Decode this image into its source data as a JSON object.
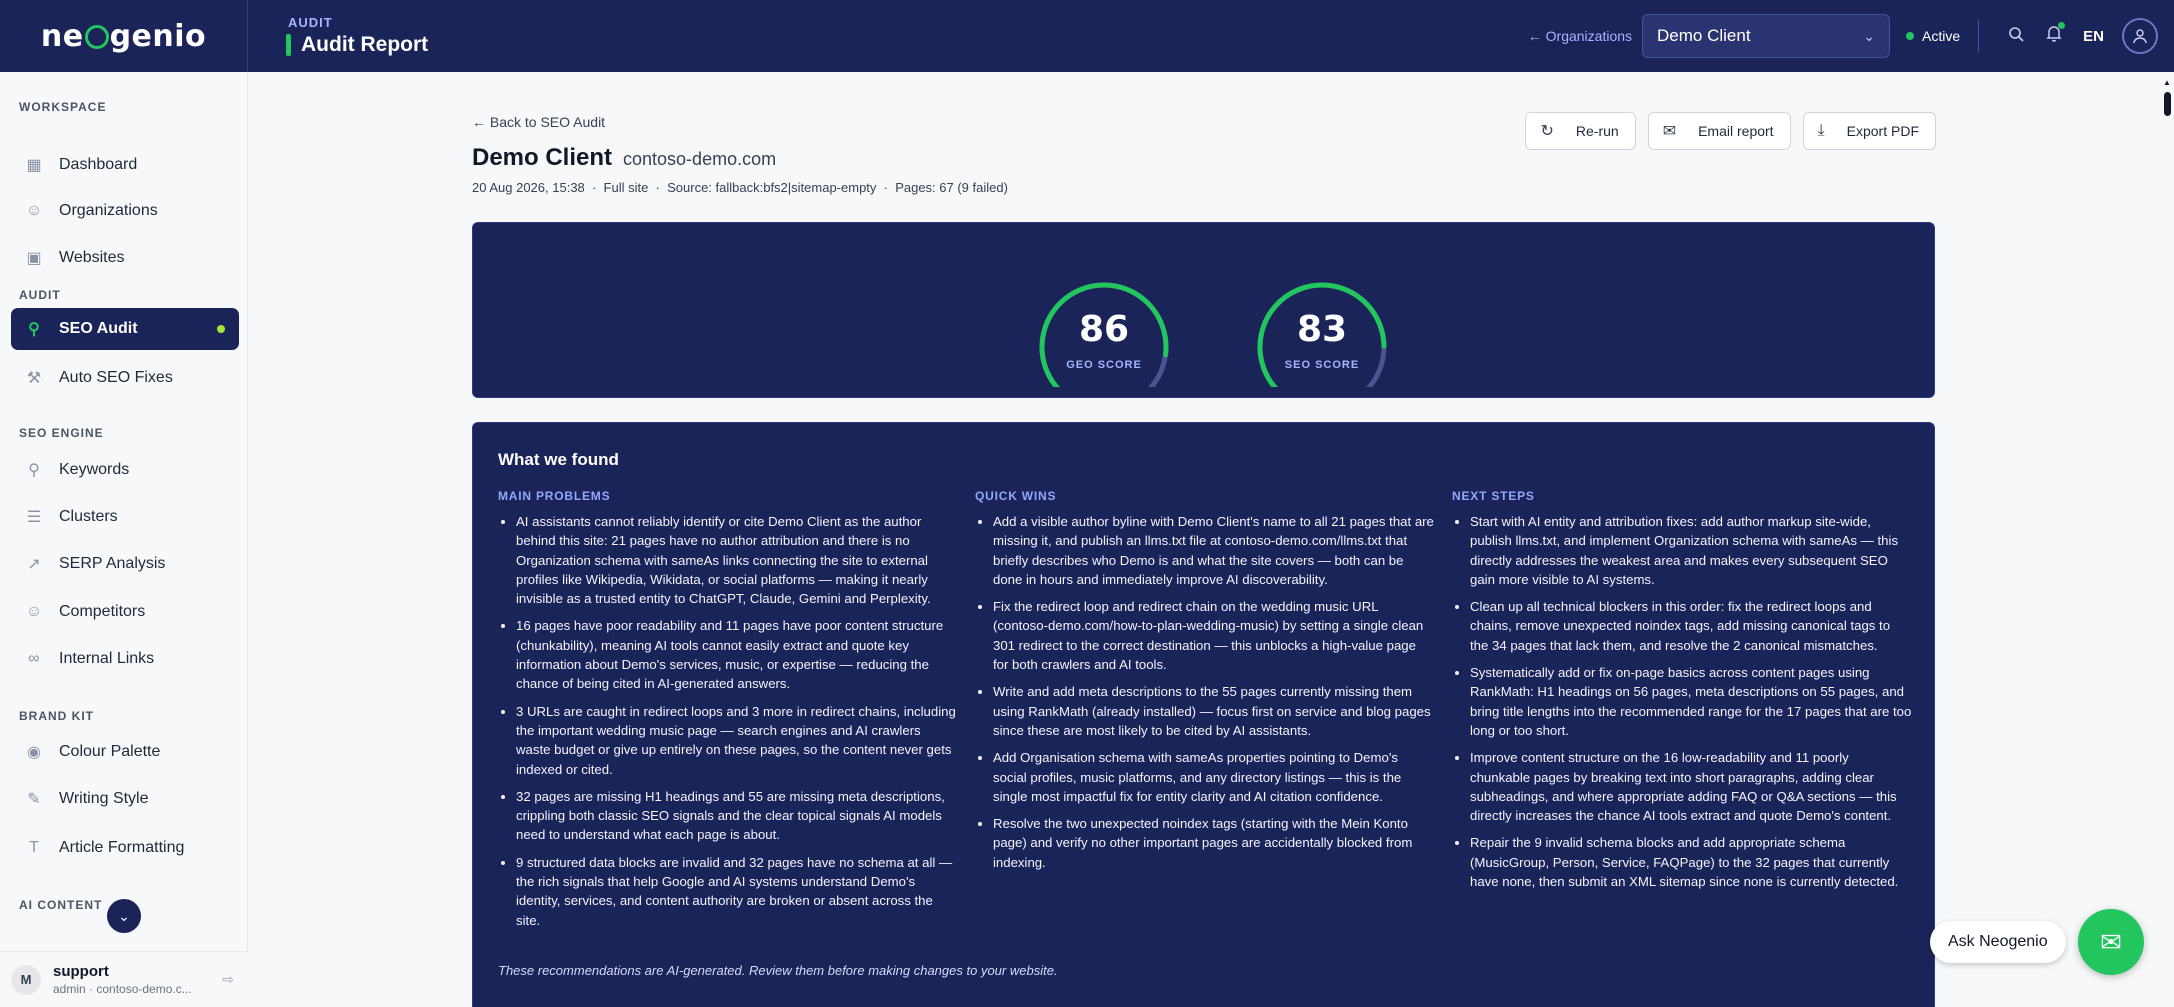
{
  "app": {
    "logo_text": "neogenio"
  },
  "header": {
    "kicker": "AUDIT",
    "title": "Audit Report",
    "org_link": "← Organizations",
    "org_selected": "Demo Client",
    "status": "Active",
    "lang": "EN"
  },
  "sidebar": {
    "sections": [
      {
        "label": "WORKSPACE"
      },
      {
        "label": "AUDIT"
      },
      {
        "label": "SEO ENGINE"
      },
      {
        "label": "BRAND KIT"
      },
      {
        "label": "AI CONTENT"
      }
    ],
    "items": [
      {
        "label": "Dashboard",
        "icon": "grid-icon"
      },
      {
        "label": "Organizations",
        "icon": "users-icon"
      },
      {
        "label": "Websites",
        "icon": "browser-icon"
      },
      {
        "label": "SEO Audit",
        "icon": "search-icon",
        "active": true
      },
      {
        "label": "Auto SEO Fixes",
        "icon": "wrench-icon"
      },
      {
        "label": "Keywords",
        "icon": "search-icon"
      },
      {
        "label": "Clusters",
        "icon": "layers-icon"
      },
      {
        "label": "SERP Analysis",
        "icon": "chart-line-icon"
      },
      {
        "label": "Competitors",
        "icon": "users-icon"
      },
      {
        "label": "Internal Links",
        "icon": "link-icon"
      },
      {
        "label": "Colour Palette",
        "icon": "palette-icon"
      },
      {
        "label": "Writing Style",
        "icon": "pen-icon"
      },
      {
        "label": "Article Formatting",
        "icon": "text-icon"
      }
    ],
    "user": {
      "initial": "M",
      "name": "support",
      "sub": "admin · contoso-demo.c..."
    }
  },
  "report": {
    "back_label": "Back to SEO Audit",
    "client_name": "Demo Client",
    "client_domain": "contoso-demo.com",
    "meta": "20 Aug 2026, 15:38  ·  Full site  ·  Source: fallback:bfs2|sitemap-empty  ·  Pages: 67 (9 failed)",
    "actions": {
      "rerun": "Re-run",
      "email": "Email report",
      "export": "Export PDF"
    },
    "scores": [
      {
        "value": "86",
        "label": "GEO SCORE",
        "fraction": 0.86
      },
      {
        "value": "83",
        "label": "SEO SCORE",
        "fraction": 0.83
      }
    ],
    "findings": {
      "title": "What we found",
      "columns": [
        {
          "heading": "MAIN PROBLEMS",
          "items": [
            "AI assistants cannot reliably identify or cite Demo Client as the author behind this site: 21 pages have no author attribution and there is no Organization schema with sameAs links connecting the site to external profiles like Wikipedia, Wikidata, or social platforms — making it nearly invisible as a trusted entity to ChatGPT, Claude, Gemini and Perplexity.",
            "16 pages have poor readability and 11 pages have poor content structure (chunkability), meaning AI tools cannot easily extract and quote key information about Demo's services, music, or expertise — reducing the chance of being cited in AI-generated answers.",
            "3 URLs are caught in redirect loops and 3 more in redirect chains, including the important wedding music page — search engines and AI crawlers waste budget or give up entirely on these pages, so the content never gets indexed or cited.",
            "32 pages are missing H1 headings and 55 are missing meta descriptions, crippling both classic SEO signals and the clear topical signals AI models need to understand what each page is about.",
            "9 structured data blocks are invalid and 32 pages have no schema at all — the rich signals that help Google and AI systems understand Demo's identity, services, and content authority are broken or absent across the site."
          ]
        },
        {
          "heading": "QUICK WINS",
          "items": [
            "Add a visible author byline with Demo Client's name to all 21 pages that are missing it, and publish an llms.txt file at contoso-demo.com/llms.txt that briefly describes who Demo is and what the site covers — both can be done in hours and immediately improve AI discoverability.",
            "Fix the redirect loop and redirect chain on the wedding music URL (contoso-demo.com/how-to-plan-wedding-music) by setting a single clean 301 redirect to the correct destination — this unblocks a high-value page for both crawlers and AI tools.",
            "Write and add meta descriptions to the 55 pages currently missing them using RankMath (already installed) — focus first on service and blog pages since these are most likely to be cited by AI assistants.",
            "Add Organisation schema with sameAs properties pointing to Demo's social profiles, music platforms, and any directory listings — this is the single most impactful fix for entity clarity and AI citation confidence.",
            "Resolve the two unexpected noindex tags (starting with the Mein Konto page) and verify no other important pages are accidentally blocked from indexing."
          ]
        },
        {
          "heading": "NEXT STEPS",
          "items": [
            "Start with AI entity and attribution fixes: add author markup site-wide, publish llms.txt, and implement Organization schema with sameAs — this directly addresses the weakest area and makes every subsequent SEO gain more visible to AI systems.",
            "Clean up all technical blockers in this order: fix the redirect loops and chains, remove unexpected noindex tags, add missing canonical tags to the 34 pages that lack them, and resolve the 2 canonical mismatches.",
            "Systematically add or fix on-page basics across content pages using RankMath: H1 headings on 56 pages, meta descriptions on 55 pages, and bring title lengths into the recommended range for the 17 pages that are too long or too short.",
            "Improve content structure on the 16 low-readability and 11 poorly chunkable pages by breaking text into short paragraphs, adding clear subheadings, and where appropriate adding FAQ or Q&A sections — this directly increases the chance AI tools extract and quote Demo's content.",
            "Repair the 9 invalid schema blocks and add appropriate schema (MusicGroup, Person, Service, FAQPage) to the 32 pages that currently have none, then submit an XML sitemap since none is currently detected."
          ]
        }
      ],
      "disclaimer": "These recommendations are AI-generated. Review them before making changes to your website."
    }
  },
  "assistant": {
    "label": "Ask Neogenio"
  },
  "colors": {
    "navy": "#1b2458",
    "accent_green": "#22c55e",
    "heading_blue": "#93a5ff"
  }
}
